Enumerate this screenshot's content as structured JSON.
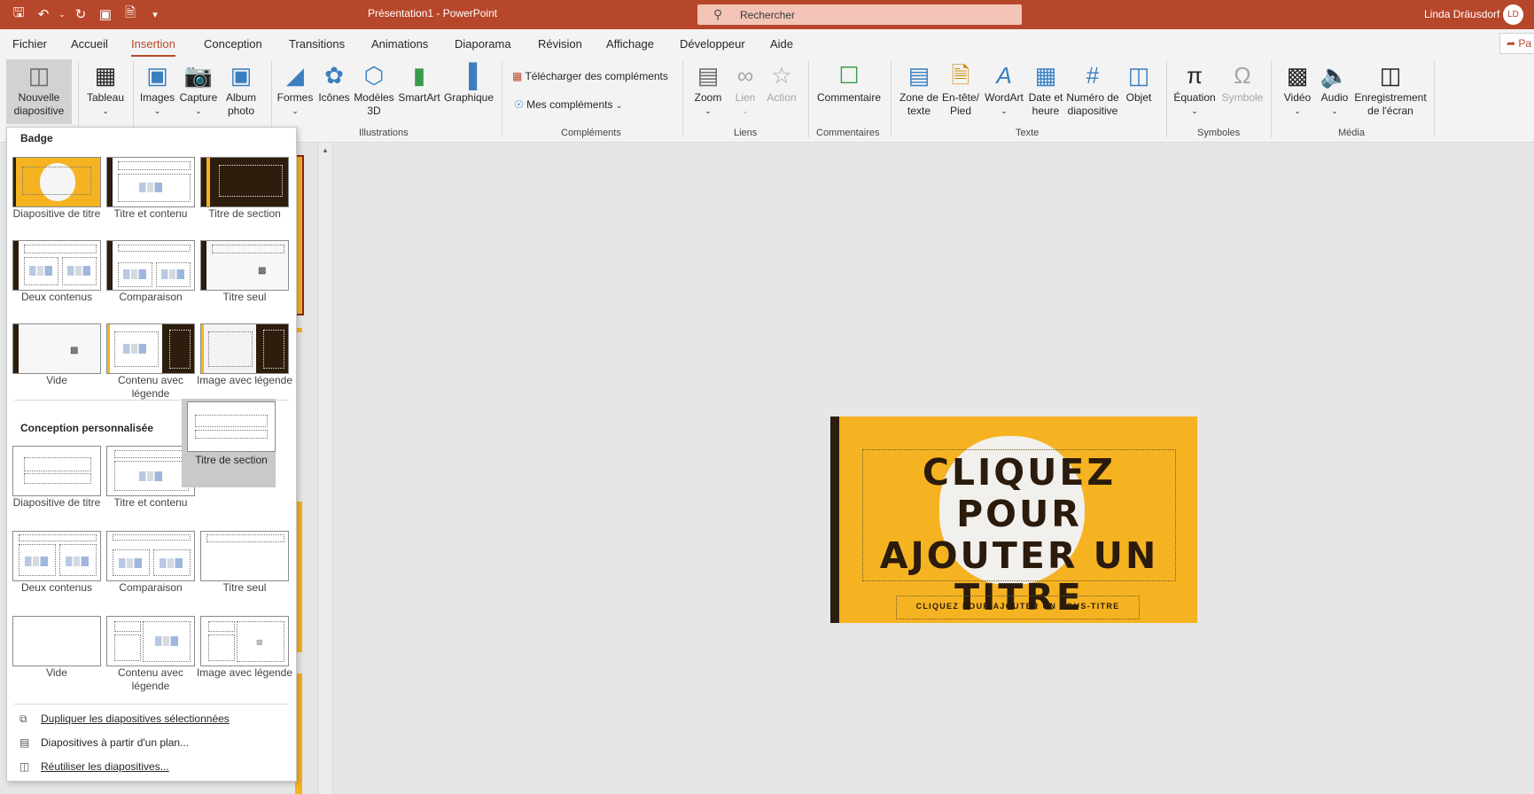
{
  "titlebar": {
    "title": "Présentation1  -  PowerPoint",
    "search_placeholder": "Rechercher",
    "user": "Linda Dräusdorf",
    "initials": "LD"
  },
  "menu": {
    "tabs": [
      "Fichier",
      "Accueil",
      "Insertion",
      "Conception",
      "Transitions",
      "Animations",
      "Diaporama",
      "Révision",
      "Affichage",
      "Développeur",
      "Aide"
    ],
    "active": "Insertion",
    "share": "Pa"
  },
  "ribbon": {
    "new_slide": "Nouvelle diapositive",
    "table": "Tableau",
    "images": "Images",
    "capture": "Capture",
    "album": "Album photo",
    "shapes": "Formes",
    "icons": "Icônes",
    "models3d": "Modèles 3D",
    "smartart": "SmartArt",
    "chart": "Graphique",
    "get_addins": "Télécharger des compléments",
    "my_addins": "Mes compléments",
    "zoom": "Zoom",
    "link": "Lien",
    "action": "Action",
    "comment": "Commentaire",
    "textbox": "Zone de texte",
    "header": "En-tête/ Pied",
    "wordart": "WordArt",
    "datetime": "Date et heure",
    "slidenum": "Numéro de diapositive",
    "object": "Objet",
    "equation": "Équation",
    "symbol": "Symbole",
    "video": "Vidéo",
    "audio": "Audio",
    "screenrec": "Enregistrement de l'écran",
    "groups": {
      "illustrations": "Illustrations",
      "addins": "Compléments",
      "links": "Liens",
      "comments": "Commentaires",
      "text": "Texte",
      "symbols": "Symboles",
      "media": "Média"
    }
  },
  "gallery": {
    "section1": "Badge",
    "badge_layouts": [
      "Diapositive de titre",
      "Titre et contenu",
      "Titre de section",
      "Deux contenus",
      "Comparaison",
      "Titre seul",
      "Vide",
      "Contenu avec légende",
      "Image avec légende"
    ],
    "section2": "Conception personnalisée",
    "custom_layouts": [
      "Diapositive de titre",
      "Titre et contenu",
      "Titre de section",
      "Deux contenus",
      "Comparaison",
      "Titre seul",
      "Vide",
      "Contenu avec légende",
      "Image avec légende"
    ],
    "footer": {
      "duplicate": "Dupliquer les diapositives sélectionnées",
      "outline": "Diapositives à partir d'un plan...",
      "reuse": "Réutiliser les diapositives..."
    }
  },
  "slide": {
    "title": "CLIQUEZ POUR AJOUTER UN TITRE",
    "subtitle": "CLIQUEZ POUR AJOUTER UN SOUS-TITRE"
  },
  "colors": {
    "accent": "#b7472a",
    "slide": "#f5b322",
    "dark": "#2d1d0c"
  }
}
